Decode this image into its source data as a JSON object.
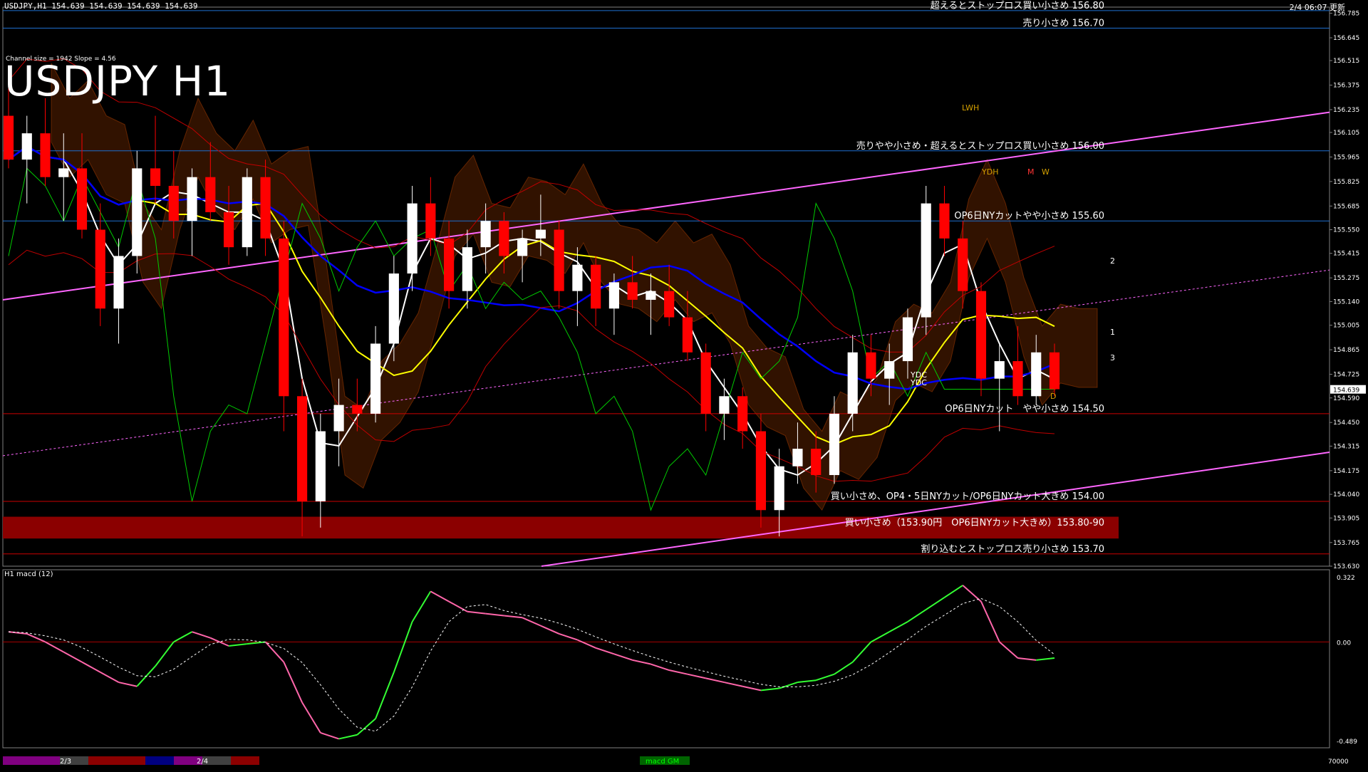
{
  "header": {
    "symbol_info": "USDJPY,H1  154.639 154.639 154.639 154.639",
    "datetime": "2/4 06:07 更新",
    "channel_info": "Channel size = 1942 Slope = 4.56",
    "title": "USDJPY H1"
  },
  "macd": {
    "label": "H1  macd (12)",
    "ticks": [
      "0.322",
      "0.00",
      "-0.489"
    ],
    "volume_label": "70000",
    "badge": "macd GM"
  },
  "date_labels": [
    "2/3",
    "2/4"
  ],
  "colors": {
    "background": "#000000",
    "bull_candle": "#ffffff",
    "bear_candle": "#ff0000",
    "level_line": "#1e6fd0",
    "support_line": "#cc0000",
    "support_band": "#8b0000",
    "trend_line": "#ff66ff",
    "ma_fast": "#ffffff",
    "ma_mid": "#ffff00",
    "ma_slow": "#0000ff",
    "chikou": "#00cc00",
    "bollinger": "#c00000",
    "kumo_bear": "#b04000",
    "kumo_bull": "#ffffff",
    "macd_up": "#33ff33",
    "macd_down": "#ff66aa"
  },
  "chart_data": {
    "type": "candlestick",
    "symbol": "USDJPY",
    "timeframe": "H1",
    "last_price": 154.639,
    "ylim": [
      153.63,
      156.82
    ],
    "y_ticks": [
      "156.785",
      "156.645",
      "156.515",
      "156.375",
      "156.235",
      "156.105",
      "155.965",
      "155.825",
      "155.685",
      "155.550",
      "155.415",
      "155.275",
      "155.140",
      "155.005",
      "154.865",
      "154.725",
      "154.590",
      "154.450",
      "154.315",
      "154.175",
      "154.040",
      "153.905",
      "153.765",
      "153.630"
    ],
    "price_label": "154.639",
    "levels": [
      {
        "price": 156.8,
        "text": "超えるとストップロス買い小さめ 156.80",
        "color": "#1e6fd0"
      },
      {
        "price": 156.7,
        "text": "売り小さめ 156.70",
        "color": "#1e6fd0"
      },
      {
        "price": 156.0,
        "text": "売りやや小さめ・超えるとストップロス買い小さめ 156.00",
        "color": "#1e6fd0"
      },
      {
        "price": 155.6,
        "text": "OP6日NYカットやや小さめ 155.60",
        "color": "#1e6fd0"
      },
      {
        "price": 154.5,
        "text": "OP6日NYカット　やや小さめ 154.50",
        "color": "#cc0000"
      },
      {
        "price": 154.0,
        "text": "買い小さめ、OP4・5日NYカット/OP6日NYカット大きめ 154.00",
        "color": "#cc0000"
      },
      {
        "price": 153.85,
        "text": "買い小さめ（153.90円　OP6日NYカット大きめ）153.80-90",
        "color": "#8b0000",
        "band": [
          153.8,
          153.9
        ]
      },
      {
        "price": 153.7,
        "text": "割り込むとストップロス売り小さめ 153.70",
        "color": "#cc0000"
      }
    ],
    "annotations": [
      "LWH",
      "YDH",
      "M",
      "W",
      "YDC",
      "YDC",
      "D",
      "1",
      "2",
      "3"
    ],
    "ohlc": [
      {
        "o": 156.2,
        "h": 156.4,
        "l": 155.9,
        "c": 155.95
      },
      {
        "o": 155.95,
        "h": 156.2,
        "l": 155.7,
        "c": 156.1
      },
      {
        "o": 156.1,
        "h": 156.3,
        "l": 155.8,
        "c": 155.85
      },
      {
        "o": 155.85,
        "h": 156.1,
        "l": 155.6,
        "c": 155.9
      },
      {
        "o": 155.9,
        "h": 156.1,
        "l": 155.5,
        "c": 155.55
      },
      {
        "o": 155.55,
        "h": 155.7,
        "l": 155.0,
        "c": 155.1
      },
      {
        "o": 155.1,
        "h": 155.5,
        "l": 154.9,
        "c": 155.4
      },
      {
        "o": 155.4,
        "h": 156.0,
        "l": 155.3,
        "c": 155.9
      },
      {
        "o": 155.9,
        "h": 156.2,
        "l": 155.7,
        "c": 155.8
      },
      {
        "o": 155.8,
        "h": 156.0,
        "l": 155.5,
        "c": 155.6
      },
      {
        "o": 155.6,
        "h": 155.9,
        "l": 155.4,
        "c": 155.85
      },
      {
        "o": 155.85,
        "h": 156.05,
        "l": 155.6,
        "c": 155.65
      },
      {
        "o": 155.65,
        "h": 155.8,
        "l": 155.35,
        "c": 155.45
      },
      {
        "o": 155.45,
        "h": 155.9,
        "l": 155.4,
        "c": 155.85
      },
      {
        "o": 155.85,
        "h": 155.95,
        "l": 155.4,
        "c": 155.5
      },
      {
        "o": 155.5,
        "h": 155.6,
        "l": 154.4,
        "c": 154.6
      },
      {
        "o": 154.6,
        "h": 154.7,
        "l": 153.8,
        "c": 154.0
      },
      {
        "o": 154.0,
        "h": 154.5,
        "l": 153.85,
        "c": 154.4
      },
      {
        "o": 154.4,
        "h": 154.7,
        "l": 154.2,
        "c": 154.55
      },
      {
        "o": 154.55,
        "h": 154.7,
        "l": 154.4,
        "c": 154.5
      },
      {
        "o": 154.5,
        "h": 155.0,
        "l": 154.45,
        "c": 154.9
      },
      {
        "o": 154.9,
        "h": 155.4,
        "l": 154.8,
        "c": 155.3
      },
      {
        "o": 155.3,
        "h": 155.8,
        "l": 155.2,
        "c": 155.7
      },
      {
        "o": 155.7,
        "h": 155.85,
        "l": 155.4,
        "c": 155.5
      },
      {
        "o": 155.5,
        "h": 155.6,
        "l": 155.1,
        "c": 155.2
      },
      {
        "o": 155.2,
        "h": 155.55,
        "l": 155.1,
        "c": 155.45
      },
      {
        "o": 155.45,
        "h": 155.7,
        "l": 155.3,
        "c": 155.6
      },
      {
        "o": 155.6,
        "h": 155.65,
        "l": 155.3,
        "c": 155.4
      },
      {
        "o": 155.4,
        "h": 155.55,
        "l": 155.25,
        "c": 155.5
      },
      {
        "o": 155.5,
        "h": 155.75,
        "l": 155.4,
        "c": 155.55
      },
      {
        "o": 155.55,
        "h": 155.6,
        "l": 155.1,
        "c": 155.2
      },
      {
        "o": 155.2,
        "h": 155.45,
        "l": 155.0,
        "c": 155.35
      },
      {
        "o": 155.35,
        "h": 155.4,
        "l": 155.0,
        "c": 155.1
      },
      {
        "o": 155.1,
        "h": 155.3,
        "l": 154.95,
        "c": 155.25
      },
      {
        "o": 155.25,
        "h": 155.4,
        "l": 155.1,
        "c": 155.15
      },
      {
        "o": 155.15,
        "h": 155.3,
        "l": 154.95,
        "c": 155.2
      },
      {
        "o": 155.2,
        "h": 155.35,
        "l": 155.0,
        "c": 155.05
      },
      {
        "o": 155.05,
        "h": 155.2,
        "l": 154.8,
        "c": 154.85
      },
      {
        "o": 154.85,
        "h": 154.9,
        "l": 154.4,
        "c": 154.5
      },
      {
        "o": 154.5,
        "h": 154.7,
        "l": 154.35,
        "c": 154.6
      },
      {
        "o": 154.6,
        "h": 154.65,
        "l": 154.3,
        "c": 154.4
      },
      {
        "o": 154.4,
        "h": 154.5,
        "l": 153.85,
        "c": 153.95
      },
      {
        "o": 153.95,
        "h": 154.3,
        "l": 153.8,
        "c": 154.2
      },
      {
        "o": 154.2,
        "h": 154.45,
        "l": 154.1,
        "c": 154.3
      },
      {
        "o": 154.3,
        "h": 154.4,
        "l": 154.05,
        "c": 154.15
      },
      {
        "o": 154.15,
        "h": 154.6,
        "l": 154.1,
        "c": 154.5
      },
      {
        "o": 154.5,
        "h": 154.95,
        "l": 154.4,
        "c": 154.85
      },
      {
        "o": 154.85,
        "h": 154.95,
        "l": 154.6,
        "c": 154.7
      },
      {
        "o": 154.7,
        "h": 154.9,
        "l": 154.55,
        "c": 154.8
      },
      {
        "o": 154.8,
        "h": 155.1,
        "l": 154.7,
        "c": 155.05
      },
      {
        "o": 155.05,
        "h": 155.8,
        "l": 154.95,
        "c": 155.7
      },
      {
        "o": 155.7,
        "h": 155.8,
        "l": 155.4,
        "c": 155.5
      },
      {
        "o": 155.5,
        "h": 155.6,
        "l": 155.1,
        "c": 155.2
      },
      {
        "o": 155.2,
        "h": 155.25,
        "l": 154.6,
        "c": 154.7
      },
      {
        "o": 154.7,
        "h": 154.9,
        "l": 154.4,
        "c": 154.8
      },
      {
        "o": 154.8,
        "h": 155.0,
        "l": 154.55,
        "c": 154.6
      },
      {
        "o": 154.6,
        "h": 154.95,
        "l": 154.55,
        "c": 154.85
      },
      {
        "o": 154.85,
        "h": 154.9,
        "l": 154.6,
        "c": 154.64
      }
    ],
    "macd_values": [
      0.05,
      0.04,
      0.0,
      -0.05,
      -0.1,
      -0.15,
      -0.2,
      -0.22,
      -0.12,
      0.0,
      0.05,
      0.02,
      -0.02,
      -0.01,
      0.0,
      -0.1,
      -0.3,
      -0.45,
      -0.48,
      -0.46,
      -0.38,
      -0.15,
      0.1,
      0.25,
      0.2,
      0.15,
      0.14,
      0.13,
      0.12,
      0.08,
      0.04,
      0.01,
      -0.03,
      -0.06,
      -0.09,
      -0.11,
      -0.14,
      -0.16,
      -0.18,
      -0.2,
      -0.22,
      -0.24,
      -0.23,
      -0.2,
      -0.19,
      -0.16,
      -0.1,
      0.0,
      0.05,
      0.1,
      0.16,
      0.22,
      0.28,
      0.2,
      0.0,
      -0.08,
      -0.09,
      -0.08
    ],
    "macd_ylim": [
      -0.489,
      0.322
    ]
  }
}
